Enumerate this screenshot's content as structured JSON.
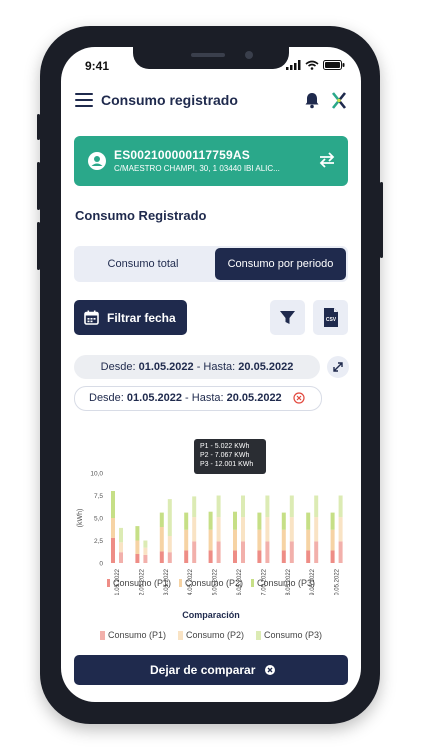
{
  "status_bar": {
    "time": "9:41"
  },
  "header": {
    "title": "Consumo registrado"
  },
  "account": {
    "cups": "ES002100000117759AS",
    "address": "C/MAESTRO CHAMPI, 30, 1 03440 IBI ALIC..."
  },
  "section": {
    "title": "Consumo Registrado"
  },
  "tabs": {
    "total": "Consumo total",
    "period": "Consumo por periodo"
  },
  "toolbar": {
    "filter_date": "Filtrar fecha",
    "csv_label": "CSV"
  },
  "range_gray": {
    "from_label": "Desde:",
    "from": "01.05.2022",
    "sep": "- Hasta:",
    "to": "20.05.2022"
  },
  "range_chip": {
    "from_label": "Desde:",
    "from": "01.05.2022",
    "sep": "- Hasta:",
    "to": "20.05.2022"
  },
  "tooltip": {
    "p1": "P1 - 5.022 KWh",
    "p2": "P2 - 7.067 KWh",
    "p3": "P3 - 12.001 KWh"
  },
  "legend": {
    "p1": "Consumo (P1)",
    "p2": "Consumo (P2)",
    "p3": "Consumo (P3)"
  },
  "comparison": {
    "title": "Comparación",
    "p1": "Consumo (P1)",
    "p2": "Consumo (P2)",
    "p3": "Consumo (P3)"
  },
  "stop_compare": {
    "label": "Dejar de comparar"
  },
  "colors": {
    "navy": "#1f2a4d",
    "teal": "#2aa88a",
    "p1": "#ee8d86",
    "p2": "#f6d3a4",
    "p3": "#c6df86"
  },
  "chart_data": {
    "type": "bar",
    "stacked": true,
    "grouped_comparison": true,
    "ylabel": "(kWh)",
    "ylim": [
      0,
      10
    ],
    "yticks": [
      "10,0",
      "7,5",
      "5,0",
      "2,5",
      "0"
    ],
    "categories": [
      "01.05.2022",
      "02.05.2022",
      "03.05.2022",
      "04.05.2022",
      "05.05.2022",
      "06.05.2022",
      "07.05.2022",
      "08.05.2022",
      "09.05.2022",
      "10.05.2022"
    ],
    "series": [
      {
        "name": "Consumo (P1)",
        "values": [
          2.8,
          1.0,
          1.3,
          1.4,
          1.4,
          1.4,
          1.4,
          1.4,
          1.4,
          1.4
        ]
      },
      {
        "name": "Consumo (P2)",
        "values": [
          2.2,
          1.5,
          2.7,
          2.3,
          2.3,
          2.3,
          2.3,
          2.3,
          2.3,
          2.3
        ]
      },
      {
        "name": "Consumo (P3)",
        "values": [
          3.0,
          1.6,
          1.6,
          1.9,
          2.0,
          2.0,
          1.9,
          1.9,
          1.9,
          1.9
        ]
      }
    ],
    "comparison_series": [
      {
        "name": "Consumo (P1)",
        "values": [
          1.2,
          0.9,
          1.2,
          2.4,
          2.4,
          2.4,
          2.4,
          2.4,
          2.4,
          2.4
        ]
      },
      {
        "name": "Consumo (P2)",
        "values": [
          1.1,
          0.8,
          1.8,
          2.7,
          2.7,
          2.7,
          2.7,
          2.7,
          2.7,
          2.7
        ]
      },
      {
        "name": "Consumo (P3)",
        "values": [
          1.6,
          0.8,
          4.1,
          2.3,
          2.4,
          2.4,
          2.4,
          2.4,
          2.4,
          2.4
        ]
      }
    ]
  }
}
